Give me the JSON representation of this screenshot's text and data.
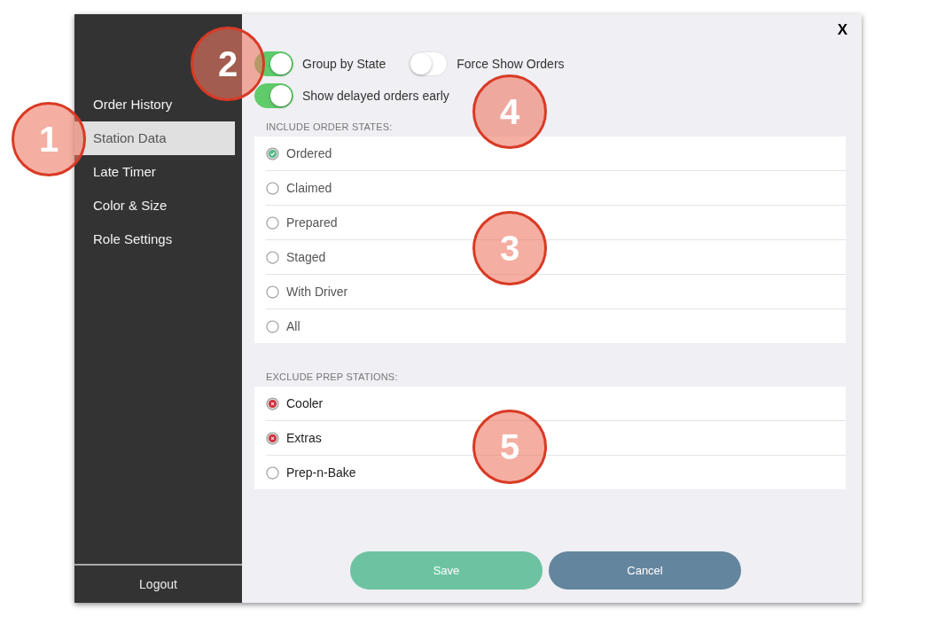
{
  "sidebar": {
    "items": [
      {
        "label": "Order History",
        "selected": false
      },
      {
        "label": "Station Data",
        "selected": true
      },
      {
        "label": "Late Timer",
        "selected": false
      },
      {
        "label": "Color & Size",
        "selected": false
      },
      {
        "label": "Role Settings",
        "selected": false
      }
    ],
    "logout": "Logout"
  },
  "close": "X",
  "toggles": [
    {
      "label": "Group by State",
      "on": true
    },
    {
      "label": "Force Show Orders",
      "on": false
    },
    {
      "label": "Show delayed orders early",
      "on": true
    }
  ],
  "include_states": {
    "heading": "INCLUDE ORDER STATES:",
    "options": [
      {
        "label": "Ordered",
        "selected": true
      },
      {
        "label": "Claimed",
        "selected": false
      },
      {
        "label": "Prepared",
        "selected": false
      },
      {
        "label": "Staged",
        "selected": false
      },
      {
        "label": "With Driver",
        "selected": false
      },
      {
        "label": "All",
        "selected": false
      }
    ]
  },
  "exclude_stations": {
    "heading": "EXCLUDE PREP STATIONS:",
    "options": [
      {
        "label": "Cooler",
        "excluded": true
      },
      {
        "label": "Extras",
        "excluded": true
      },
      {
        "label": "Prep-n-Bake",
        "excluded": false
      }
    ]
  },
  "buttons": [
    {
      "label": "Save",
      "kind": "save"
    },
    {
      "label": "Cancel",
      "kind": "cancel"
    }
  ],
  "callouts": [
    "2",
    "4",
    "1",
    "3",
    "5"
  ]
}
